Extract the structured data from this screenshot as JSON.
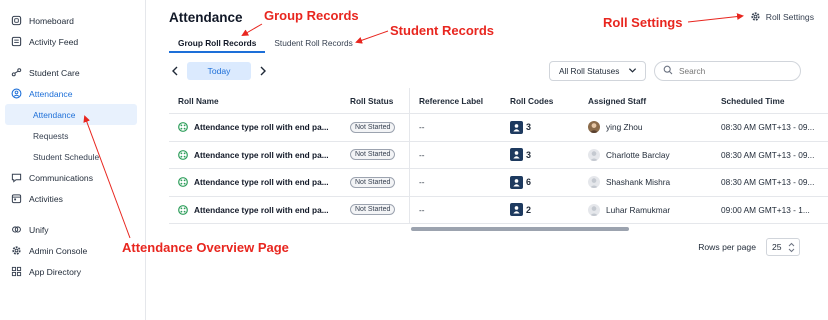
{
  "sidebar": {
    "items": [
      {
        "label": "Homeboard",
        "icon": "home-icon"
      },
      {
        "label": "Activity Feed",
        "icon": "feed-icon"
      },
      {
        "label": "Student Care",
        "icon": "care-icon"
      },
      {
        "label": "Attendance",
        "icon": "attendance-icon"
      },
      {
        "label": "Attendance"
      },
      {
        "label": "Requests"
      },
      {
        "label": "Student Schedule"
      },
      {
        "label": "Communications",
        "icon": "chat-icon"
      },
      {
        "label": "Activities",
        "icon": "activities-icon"
      },
      {
        "label": "Unify",
        "icon": "unify-icon"
      },
      {
        "label": "Admin Console",
        "icon": "gear-icon"
      },
      {
        "label": "App Directory",
        "icon": "grid-icon"
      }
    ]
  },
  "header": {
    "title": "Attendance",
    "roll_settings": "Roll Settings"
  },
  "tabs": [
    {
      "label": "Group Roll Records",
      "active": true
    },
    {
      "label": "Student Roll Records",
      "active": false
    }
  ],
  "toolbar": {
    "today": "Today",
    "status_filter": "All Roll Statuses",
    "search_placeholder": "Search"
  },
  "table": {
    "headers": [
      "Roll Name",
      "Roll Status",
      "Reference Label",
      "Roll Codes",
      "Assigned Staff",
      "Scheduled Time"
    ],
    "rows": [
      {
        "name": "Attendance type roll with end pa...",
        "status": "Not Started",
        "ref": "--",
        "codes": "3",
        "staff": "ying Zhou",
        "photo": true,
        "time": "08:30 AM GMT+13 - 09..."
      },
      {
        "name": "Attendance type roll with end pa...",
        "status": "Not Started",
        "ref": "--",
        "codes": "3",
        "staff": "Charlotte Barclay",
        "photo": false,
        "time": "08:30 AM GMT+13 - 09..."
      },
      {
        "name": "Attendance type roll with end pa...",
        "status": "Not Started",
        "ref": "--",
        "codes": "6",
        "staff": "Shashank Mishra",
        "photo": false,
        "time": "08:30 AM GMT+13 - 09..."
      },
      {
        "name": "Attendance type roll with end pa...",
        "status": "Not Started",
        "ref": "--",
        "codes": "2",
        "staff": "Luhar Ramukmar",
        "photo": false,
        "time": "09:00 AM GMT+13 - 1..."
      }
    ]
  },
  "pagination": {
    "rows_per_page_label": "Rows per page",
    "rows_per_page_value": "25"
  },
  "annotations": {
    "group_records": "Group Records",
    "student_records": "Student Records",
    "roll_settings": "Roll Settings",
    "overview": "Attendance Overview Page"
  },
  "colors": {
    "accent": "#1d6fd8",
    "annotation": "#e8261f",
    "code_icon": "#1e3a5f",
    "roll_icon": "#2e9e5b"
  }
}
